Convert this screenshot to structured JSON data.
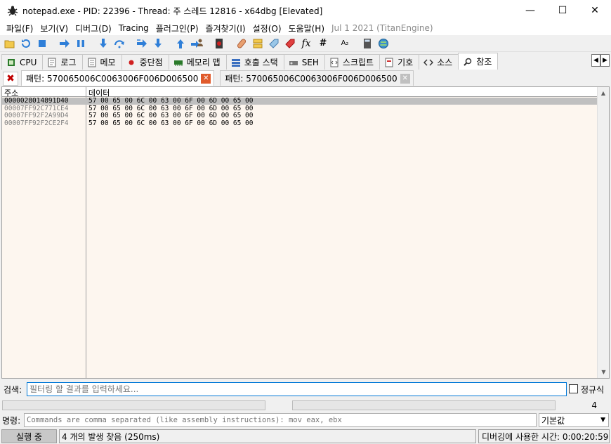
{
  "window": {
    "title": "notepad.exe - PID: 22396 - Thread: 주 스레드 12816 - x64dbg [Elevated]",
    "min_glyph": "—",
    "max_glyph": "☐",
    "close_glyph": "✕"
  },
  "menu": {
    "items": [
      "파일(F)",
      "보기(V)",
      "디버그(D)",
      "Tracing",
      "플러그인(P)",
      "즐겨찾기(I)",
      "설정(O)",
      "도움말(H)"
    ],
    "version": "Jul 1 2021 (TitanEngine)"
  },
  "toolbar": {
    "icons": [
      "open-icon",
      "restart-icon",
      "stop-icon",
      "run-icon",
      "pause-icon",
      "step-into-icon",
      "step-over-icon",
      "trace-into-icon",
      "trace-over-icon",
      "execute-till-return-icon",
      "run-to-user-code-icon",
      "scylla-icon",
      "patch-icon",
      "comments-icon",
      "labels-icon",
      "bookmarks-icon",
      "functions-icon",
      "hash-icon",
      "font-icon",
      "calculator-icon",
      "globe-icon"
    ],
    "hash_glyph": "#",
    "font_glyph": "A₂",
    "fx_glyph": "fx"
  },
  "tabs": [
    {
      "label": "CPU",
      "icon": "cpu-icon"
    },
    {
      "label": "로그",
      "icon": "log-icon"
    },
    {
      "label": "메모",
      "icon": "notes-icon"
    },
    {
      "label": "중단점",
      "icon": "breakpoint-icon"
    },
    {
      "label": "메모리 맵",
      "icon": "memory-map-icon"
    },
    {
      "label": "호출 스택",
      "icon": "call-stack-icon"
    },
    {
      "label": "SEH",
      "icon": "seh-icon"
    },
    {
      "label": "스크립트",
      "icon": "script-icon"
    },
    {
      "label": "기호",
      "icon": "symbols-icon"
    },
    {
      "label": "소스",
      "icon": "source-icon"
    },
    {
      "label": "참조",
      "icon": "references-icon"
    }
  ],
  "subtabs": [
    {
      "label": "패턴: 570065006C0063006F006D006500",
      "active": true
    },
    {
      "label": "패턴: 570065006C0063006F006D006500",
      "active": false
    }
  ],
  "table": {
    "headers": [
      "주소",
      "데이터"
    ],
    "rows": [
      {
        "address": "0000028014891D40",
        "data": "57 00 65 00 6C 00 63 00 6F 00 6D 00 65 00"
      },
      {
        "address": "00007FF92C771CE4",
        "data": "57 00 65 00 6C 00 63 00 6F 00 6D 00 65 00"
      },
      {
        "address": "00007FF92F2A99D4",
        "data": "57 00 65 00 6C 00 63 00 6F 00 6D 00 65 00"
      },
      {
        "address": "00007FF92F2CE2F4",
        "data": "57 00 65 00 6C 00 63 00 6F 00 6D 00 65 00"
      }
    ]
  },
  "search": {
    "label": "검색:",
    "placeholder": "필터링 할 결과를 입력하세요...",
    "regex_label": "정규식"
  },
  "count": "4",
  "command": {
    "label": "명령:",
    "placeholder": "Commands are comma separated (like assembly instructions): mov eax, ebx",
    "mode": "기본값"
  },
  "status": {
    "state": "실행 중",
    "message": "4 개의 발생 찾음 (250ms)",
    "time": "디버깅에 사용한 시간: 0:00:20:59"
  }
}
